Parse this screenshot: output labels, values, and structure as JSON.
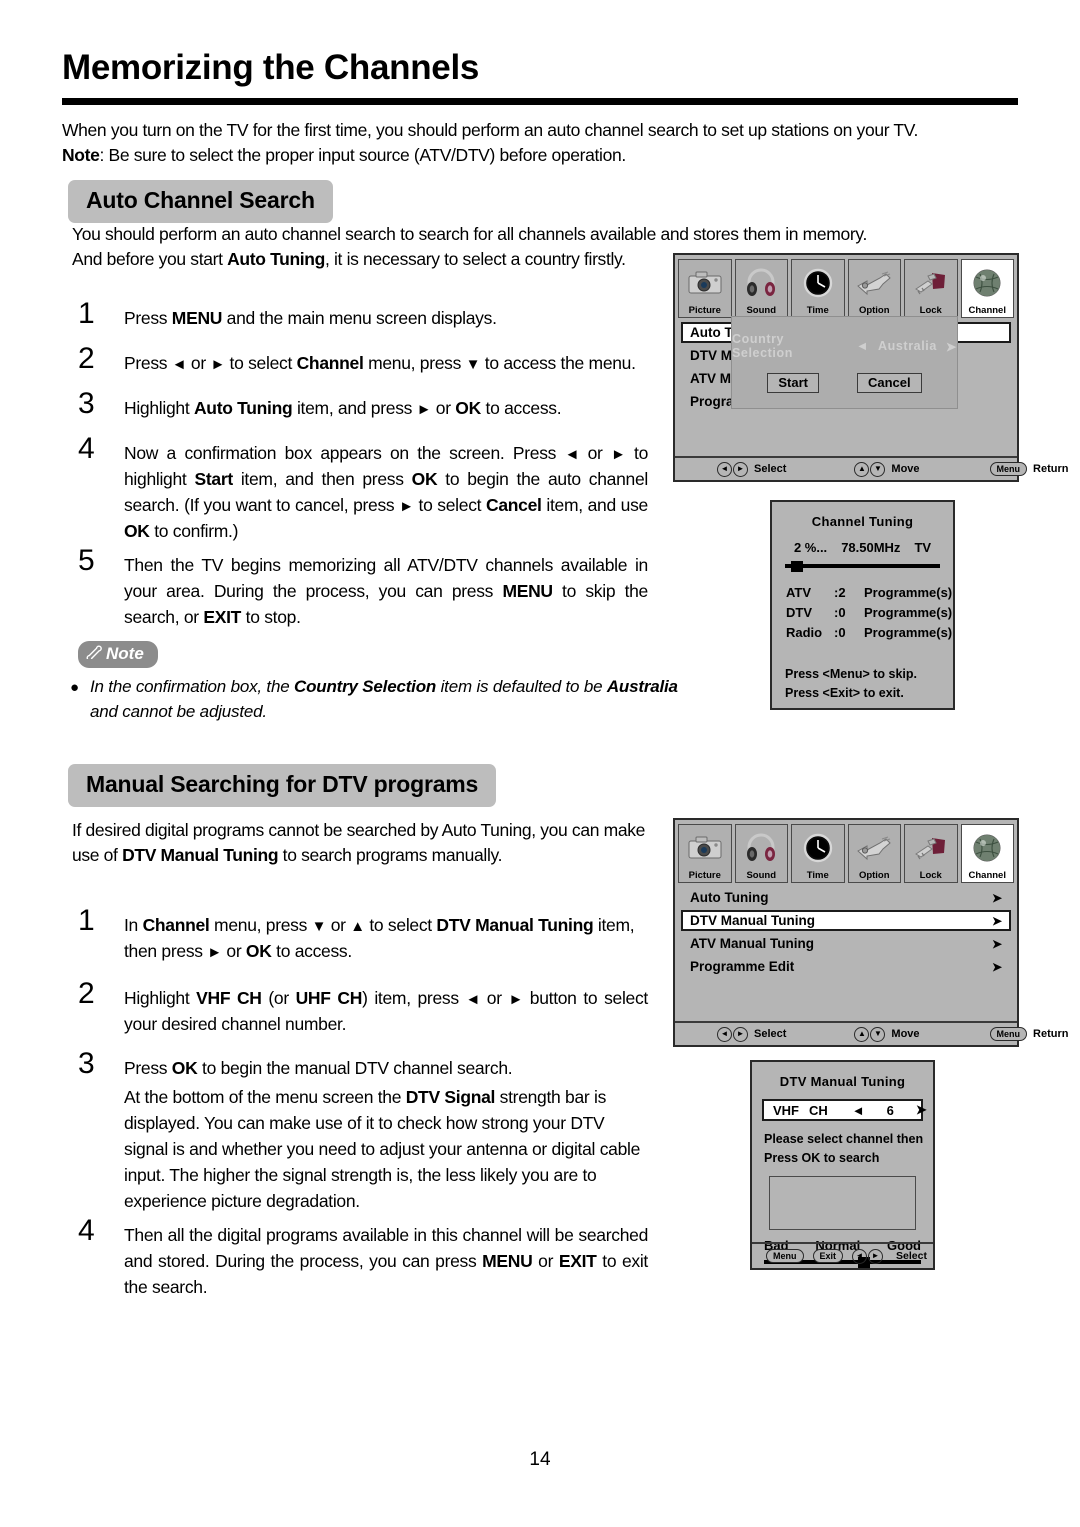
{
  "page": {
    "title": "Memorizing the Channels",
    "number": "14",
    "intro_line1": "When you turn on the TV for the first time, you should perform an auto channel search to set up stations on your TV.",
    "intro_line2_label": "Note",
    "intro_line2": ":  Be sure to select the proper input source (ATV/DTV) before operation."
  },
  "section_auto": {
    "pill": "Auto Channel Search",
    "para_line1": "You should perform an auto channel search to search for all channels available and stores them in memory.",
    "para_line2_a": "And before you start ",
    "para_line2_b": "Auto Tuning",
    "para_line2_c": ", it is necessary to select a country firstly.",
    "steps": [
      {
        "num": "1",
        "html_id": "a1"
      },
      {
        "num": "2",
        "html_id": "a2"
      },
      {
        "num": "3",
        "html_id": "a3"
      },
      {
        "num": "4",
        "html_id": "a4"
      },
      {
        "num": "5",
        "html_id": "a5"
      }
    ],
    "step1": {
      "t1": "Press ",
      "b1": "MENU",
      "t2": " and the main menu screen displays."
    },
    "step2": {
      "t1": "Press ",
      "a1": "◄",
      "t2": " or ",
      "a2": "►",
      "t3": " to select ",
      "b1": "Channel",
      "t4": " menu,  press ",
      "a3": "▼",
      "t5": " to access the menu."
    },
    "step3": {
      "t1": "Highlight ",
      "b1": "Auto Tuning",
      "t2": " item, and press ",
      "a1": "►",
      "t3": " or ",
      "b2": "OK",
      "t4": " to access."
    },
    "step4": {
      "t1": "Now a confirmation box appears on the screen. Press ",
      "a1": "◄",
      "t2": " or ",
      "a2": "►",
      "t3": " to highlight ",
      "b1": "Start",
      "t4": " item, and then press ",
      "b2": "OK",
      "t5": " to begin the auto channel search. (If you want to cancel, press ",
      "a3": "►",
      "t6": " to select ",
      "b3": "Cancel",
      "t7": " item, and use ",
      "b4": "OK",
      "t8": " to confirm.)"
    },
    "step5": {
      "t1": "Then the TV begins memorizing all ATV/DTV channels available in your area. During the process, you can press ",
      "b1": "MENU",
      "t2": " to skip the search, or ",
      "b2": "EXIT",
      "t3": " to stop."
    },
    "note": {
      "badge": "Note",
      "bullet": "●",
      "t1": "In the confirmation box, the ",
      "b1": "Country Selection",
      "t2": " item is defaulted to be ",
      "b2": "Australia",
      "t3": " and cannot be adjusted."
    }
  },
  "section_manual": {
    "pill": "Manual Searching for DTV programs",
    "para_t1": "If desired digital programs cannot be searched by Auto Tuning, you can make use of ",
    "para_b1": "DTV Manual Tuning",
    "para_t2": " to search programs manually.",
    "step1": {
      "t1": "In ",
      "b1": "Channel",
      "t2": " menu,  press ",
      "a1": "▼",
      "t3": " or ",
      "a2": "▲",
      "t4": " to select ",
      "b2": "DTV Manual Tuning",
      "t5": " item, then press ",
      "a3": "►",
      "t6": " or ",
      "b3": "OK",
      "t7": " to access."
    },
    "step2": {
      "t1": "Highlight ",
      "b1": "VHF CH",
      "t2": " (or ",
      "b2": "UHF CH",
      "t3": ") item, press ",
      "a1": "◄",
      "t4": " or ",
      "a2": "►",
      "t5": " button to select your desired channel number."
    },
    "step3": {
      "t1": "Press ",
      "b1": "OK",
      "t2": " to begin the manual DTV  channel search.",
      "p1": "At the bottom of the menu screen the ",
      "b2": "DTV Signal",
      "p2": " strength bar is displayed. You can make use of it to check how strong your DTV signal is and whether you need to adjust your antenna or digital cable input. The higher the signal strength is, the less likely you are to experience picture degradation."
    },
    "step4": {
      "t1": "Then all the digital programs available in this channel will be searched and stored. During the process, you can press ",
      "b1": "MENU",
      "t2": " or ",
      "b2": "EXIT",
      "t3": " to exit the search."
    },
    "step_nums": [
      "1",
      "2",
      "3",
      "4"
    ]
  },
  "osd": {
    "tabs": [
      {
        "label": "Picture",
        "icon": "camera-icon",
        "active": false
      },
      {
        "label": "Sound",
        "icon": "headphones-icon",
        "active": false
      },
      {
        "label": "Time",
        "icon": "clock-icon",
        "active": false
      },
      {
        "label": "Option",
        "icon": "connector-icon",
        "active": false
      },
      {
        "label": "Lock",
        "icon": "key-icon",
        "active": false
      },
      {
        "label": "Channel",
        "icon": "globe-icon",
        "active": true
      }
    ],
    "bottom_bar": {
      "select": "Select",
      "move": "Move",
      "return": "Return",
      "menu_key": "Menu",
      "left_glyph": "◄",
      "right_glyph": "►",
      "up_glyph": "▲",
      "down_glyph": "▼"
    },
    "menu1_items": [
      "Auto Tun",
      "DTV Man",
      "ATV Man",
      "Program"
    ],
    "menu1_selected_index": 0,
    "menu2_items": [
      "Auto Tuning",
      "DTV Manual Tuning",
      "ATV Manual Tuning",
      "Programme Edit"
    ],
    "menu2_selected_index": 1,
    "menu2_arrow": "➤",
    "dialog": {
      "country_label": "Country  Selection",
      "left_arrow": "◄",
      "value": "Australia",
      "right_arrow": "➤",
      "start": "Start",
      "cancel": "Cancel"
    },
    "tuning_popup": {
      "title": "Channel  Tuning",
      "percent": "2  %...",
      "frequency": "78.50MHz",
      "mode": "TV",
      "progress_percent": 4,
      "rows": [
        {
          "name": "ATV",
          "value": ":2",
          "unit": "Programme(s)"
        },
        {
          "name": "DTV",
          "value": ":0",
          "unit": "Programme(s)"
        },
        {
          "name": "Radio",
          "value": ":0",
          "unit": "Programme(s)"
        }
      ],
      "hint1": "Press <Menu> to skip.",
      "hint2": "Press <Exit> to exit."
    },
    "manual_popup": {
      "title": "DTV Manual Tuning",
      "band": "VHF",
      "ch_label": "CH",
      "left_arrow": "◄",
      "channel": "6",
      "right_arrow": "➤",
      "msg1": "Please select channel then",
      "msg2": "Press OK to search",
      "scale_bad": "Bad",
      "scale_normal": "Normal",
      "scale_good": "Good",
      "signal_percent": 60,
      "menu_key": "Menu",
      "exit_key": "Exit",
      "select": "Select"
    }
  },
  "colors": {
    "pill_bg": "#bdbdbd",
    "note_bg": "#8c8c8c",
    "osd_bg": "#b5b5b5",
    "osd_border": "#2a2a2a",
    "dialog_bg": "#adadad",
    "dialog_text": "#cfcfcf"
  }
}
